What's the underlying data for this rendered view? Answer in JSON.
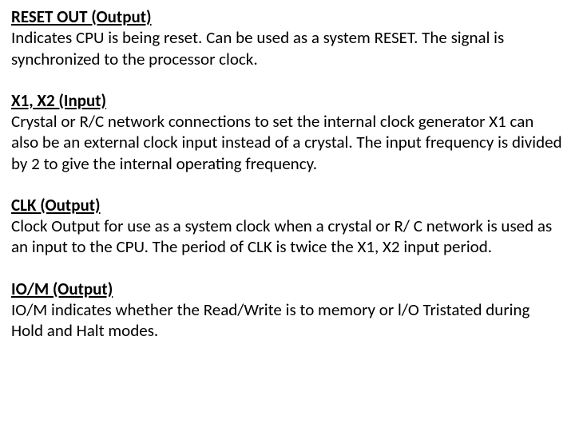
{
  "sections": [
    {
      "heading": "RESET OUT (Output)",
      "body": "Indicates CPU is being reset. Can be used as a system RESET. The signal is\nsynchronized to the processor clock."
    },
    {
      "heading": "X1, X2 (Input)",
      "body": "Crystal or R/C network connections to set the internal clock generator X1 can also be an external clock input instead of a crystal. The input frequency is divided by 2 to give the internal operating frequency."
    },
    {
      "heading": "CLK (Output)",
      "body": "Clock Output for use as a system clock when a crystal or R/ C network is used as an input to the CPU. The period of CLK is twice the X1, X2 input period."
    },
    {
      "heading": "IO/M (Output)",
      "body": "IO/M indicates whether the Read/Write is to memory or l/O Tristated during Hold and Halt modes."
    }
  ]
}
